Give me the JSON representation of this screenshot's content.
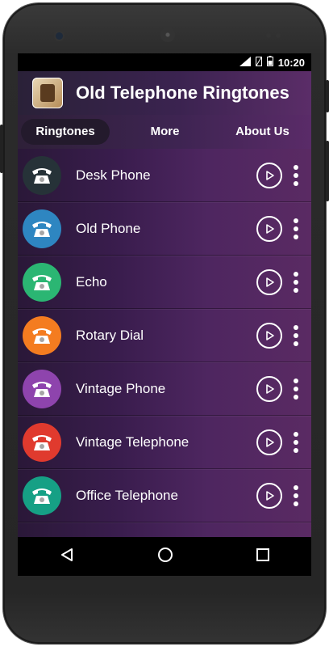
{
  "status_bar": {
    "time": "10:20"
  },
  "header": {
    "title": "Old Telephone Ringtones",
    "app_icon": "vintage-telephone-icon"
  },
  "tabs": [
    {
      "label": "Ringtones",
      "active": true
    },
    {
      "label": "More",
      "active": false
    },
    {
      "label": "About Us",
      "active": false
    }
  ],
  "ringtones": [
    {
      "label": "Desk Phone",
      "color": "#263238",
      "icon": "desk-phone-icon"
    },
    {
      "label": "Old Phone",
      "color": "#2E86C1",
      "icon": "old-phone-icon"
    },
    {
      "label": "Echo",
      "color": "#2BB673",
      "icon": "echo-phone-icon"
    },
    {
      "label": "Rotary Dial",
      "color": "#F47C20",
      "icon": "rotary-phone-icon"
    },
    {
      "label": "Vintage Phone",
      "color": "#8E44AD",
      "icon": "vintage-phone-icon"
    },
    {
      "label": "Vintage Telephone",
      "color": "#E03A2E",
      "icon": "ringing-phone-icon"
    },
    {
      "label": "Office Telephone",
      "color": "#16A085",
      "icon": "office-phone-icon"
    }
  ],
  "colors": {
    "header_gradient_start": "#2a2138",
    "header_gradient_end": "#5b2d68"
  }
}
